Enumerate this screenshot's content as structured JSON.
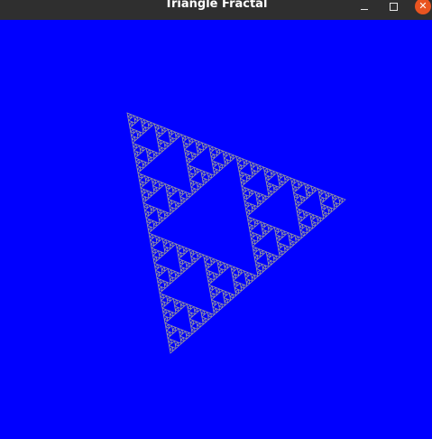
{
  "window": {
    "title": "Triangle Fractal"
  },
  "controls": {
    "minimize_icon": "minimize-icon",
    "maximize_icon": "maximize-icon",
    "close_icon": "close-icon",
    "close_glyph": "✕"
  },
  "colors": {
    "canvas_background": "#0000ff",
    "fractal_stroke": "#9a9a9a",
    "titlebar": "#2f2f2f",
    "close_button": "#e95420"
  },
  "fractal": {
    "type": "sierpinski-triangle",
    "depth": 6
  }
}
